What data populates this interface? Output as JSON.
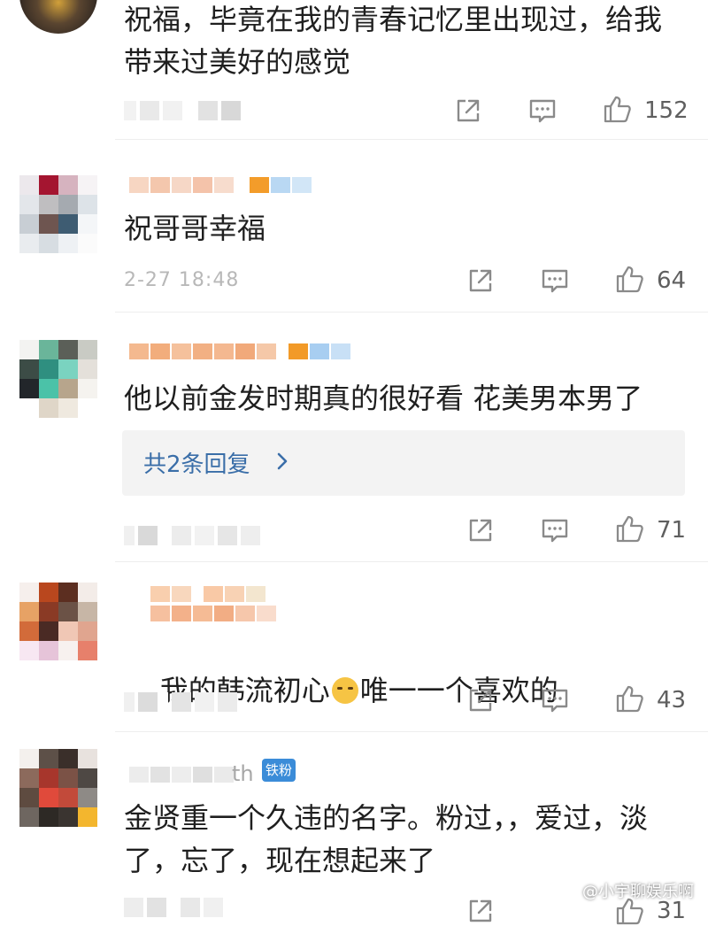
{
  "colors": {
    "like_count": "#5f5f5f",
    "reply_link": "#3a6ea8",
    "badge_bg": "#3b8cd8",
    "reply_box_bg": "#f3f3f3",
    "time_text": "#b8b8b8"
  },
  "comments": [
    {
      "text": "祝福，毕竟在我的青春记忆里出现过，给我\n带来过美好的感觉",
      "likes": "152"
    },
    {
      "text": "祝哥哥幸福",
      "time": "2-27 18:48",
      "likes": "64"
    },
    {
      "text": "他以前金发时期真的很好看 花美男本男了",
      "reply_link": "共2条回复",
      "likes": "71"
    },
    {
      "text_before": "我的韩流初心",
      "text_after": "唯一一个喜欢的",
      "emoji": "crying-face-icon",
      "likes": "43"
    },
    {
      "text": "金贤重一个久违的名字。粉过，，爱过，淡\n了，忘了，现在想起来了",
      "badge": "铁粉",
      "name_suffix": "th",
      "likes": "31"
    }
  ],
  "icons": {
    "share": "share-icon",
    "comment": "comment-icon",
    "like": "thumbs-up-icon",
    "reply_chevron": "chevron-right-icon"
  },
  "watermark": "小宇聊娱乐啊"
}
